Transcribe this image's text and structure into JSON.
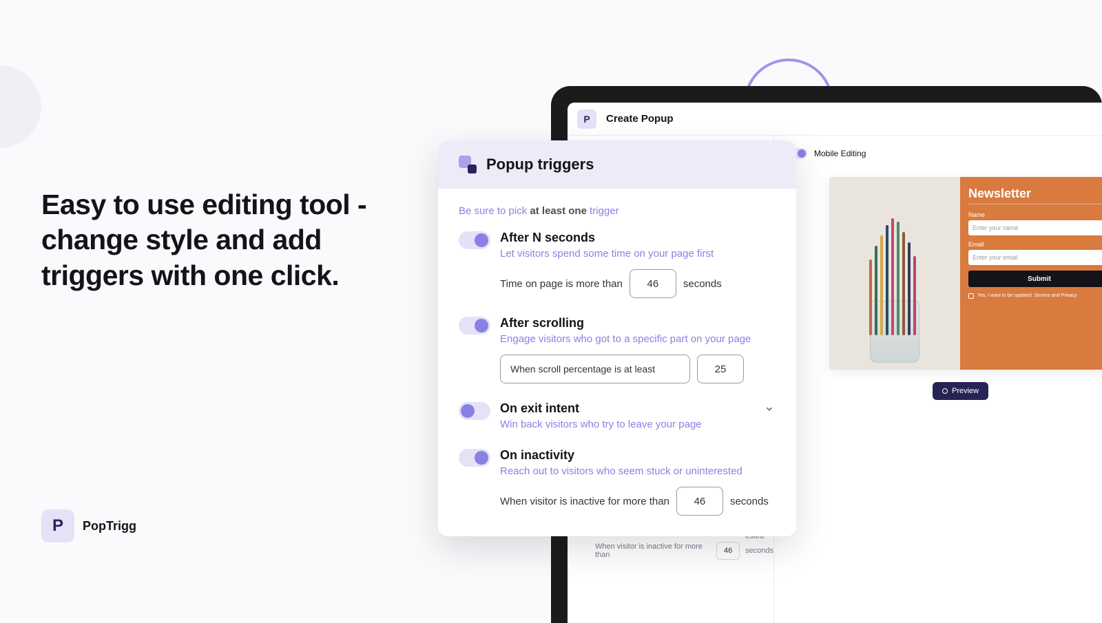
{
  "hero": {
    "text": "Easy to use editing tool - change style and add triggers with one click."
  },
  "brand": {
    "name": "PopTrigg",
    "initial": "P"
  },
  "app": {
    "header_title": "Create Popup",
    "mobile_editing_label": "Mobile Editing",
    "preview_button": "Preview",
    "bg_inactive_label": "When visitor is inactive for more than",
    "bg_inactive_value": "46",
    "bg_inactive_unit": "seconds"
  },
  "preview_form": {
    "title": "Newsletter",
    "name_label": "Name",
    "name_placeholder": "Enter your name",
    "email_label": "Email",
    "email_placeholder": "Enter your email",
    "submit": "Submit",
    "consent": "Yes, I want to be updated. Service and Privacy"
  },
  "panel": {
    "title": "Popup triggers",
    "hint_prefix": "Be sure to pick ",
    "hint_bold": "at least one",
    "hint_suffix": " trigger",
    "triggers": {
      "after_seconds": {
        "title": "After N seconds",
        "desc": "Let visitors spend some time on your page first",
        "label_prefix": "Time on page is more than",
        "value": "46",
        "label_suffix": "seconds"
      },
      "after_scrolling": {
        "title": "After scrolling",
        "desc": "Engage visitors who got to a specific part on your page",
        "dropdown_label": "When scroll percentage is at least",
        "value": "25"
      },
      "exit_intent": {
        "title": "On exit intent",
        "desc": "Win back visitors who try to leave your page"
      },
      "inactivity": {
        "title": "On inactivity",
        "desc": "Reach out to visitors who seem stuck or uninterested",
        "label_prefix": "When visitor is inactive for more than",
        "value": "46",
        "label_suffix": "seconds"
      }
    }
  }
}
